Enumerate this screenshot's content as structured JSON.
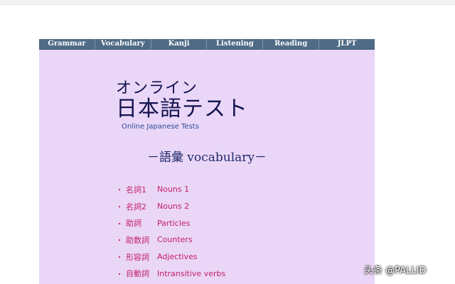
{
  "nav": {
    "items": [
      "Grammar",
      "Vocabulary",
      "Kanji",
      "Listening",
      "Reading",
      "JLPT"
    ]
  },
  "header": {
    "title_small": "オンライン",
    "title_big": "日本語テスト",
    "subtitle": "Online Japanese Tests"
  },
  "section": {
    "heading": "－語彙 vocabulary－"
  },
  "menu": {
    "bullet": "・",
    "items": [
      {
        "jp": "名詞1",
        "en": "Nouns 1"
      },
      {
        "jp": "名詞2",
        "en": "Nouns 2"
      },
      {
        "jp": "助詞",
        "en": "Particles"
      },
      {
        "jp": "助数詞",
        "en": "Counters"
      },
      {
        "jp": "形容詞",
        "en": "Adjectives"
      },
      {
        "jp": "自動詞",
        "en": "Intransitive verbs"
      }
    ]
  },
  "watermark": "头条 @PALLID",
  "colors": {
    "page_bg": "#ead6f7",
    "nav_bg": "#4f6b86",
    "title": "#12124f",
    "subtitle": "#2a4f9a",
    "link": "#c21f6a"
  }
}
